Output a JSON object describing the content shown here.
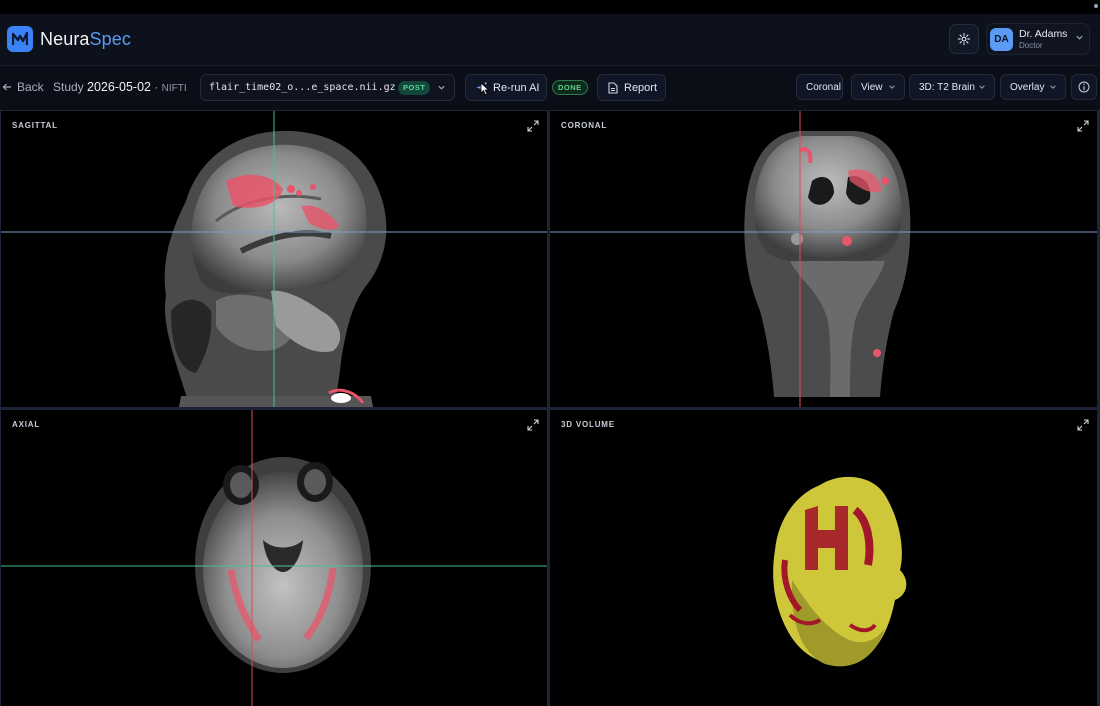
{
  "app": {
    "brand_part1": "Neura",
    "brand_part2": "Spec",
    "logo_glyph": "M",
    "accent": "#3b82f6"
  },
  "user": {
    "initials": "DA",
    "name": "Dr. Adams",
    "role": "Doctor"
  },
  "toolbar": {
    "back_label": "Back",
    "study_label": "Study",
    "study_date": "2026-05-02",
    "study_sep": "·",
    "study_format": "NIFTI",
    "file_name": "flair_time02_o...e_space.nii.gz",
    "file_badge": "POST",
    "rerun_label": "Re-run AI",
    "status_badge": "DONE",
    "report_label": "Report",
    "plane_label": "Coronal",
    "view_label": "View",
    "volume_label": "3D: T2 Brain",
    "overlay_label": "Overlay"
  },
  "viewports": {
    "sagittal": "SAGITTAL",
    "coronal": "CORONAL",
    "axial": "AXIAL",
    "volume": "3D VOLUME"
  },
  "colors": {
    "lesion_overlay": "#e8556a",
    "crosshair_horizontal": "#7f9cc9",
    "crosshair_sagittal_vertical": "#49c08f",
    "crosshair_red": "#e04a5c",
    "volume_tissue": "#d8d13a",
    "volume_lesion": "#a3172a"
  },
  "icons": {
    "logo": "neuraspec-logo-icon",
    "settings": "gear-icon",
    "back": "arrow-left-icon",
    "rerun": "sparkle-icon",
    "report": "document-icon",
    "info": "info-icon",
    "expand": "expand-icon",
    "chevron": "chevron-down-icon"
  }
}
